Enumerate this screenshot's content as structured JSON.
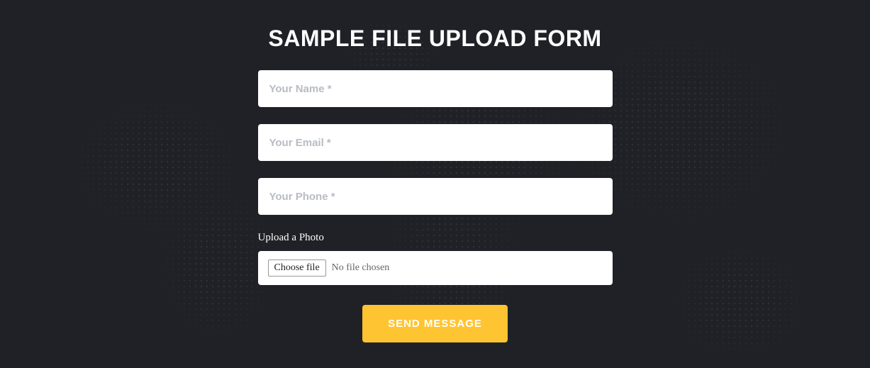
{
  "form": {
    "title": "SAMPLE FILE UPLOAD FORM",
    "name_placeholder": "Your Name *",
    "email_placeholder": "Your Email *",
    "phone_placeholder": "Your Phone *",
    "upload_label": "Upload a Photo",
    "choose_file_label": "Choose file",
    "file_status": "No file chosen",
    "submit_label": "SEND MESSAGE"
  },
  "colors": {
    "background": "#1f2126",
    "accent": "#ffc431",
    "text_light": "#ffffff",
    "placeholder": "#b8bcc2"
  }
}
